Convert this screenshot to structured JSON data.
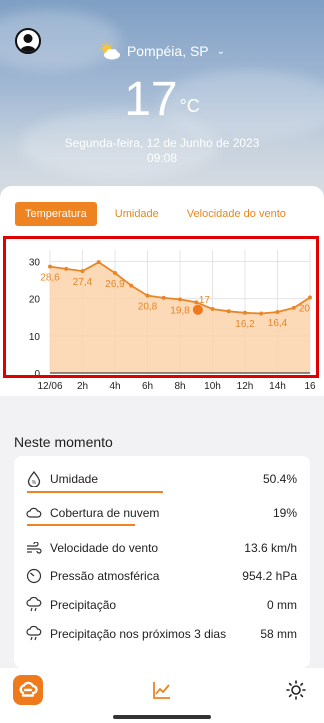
{
  "header": {
    "location": "Pompéia, SP",
    "temperature": "17",
    "temp_unit": "°C",
    "date": "Segunda-feira, 12 de Junho de 2023",
    "time": "09:08"
  },
  "tabs": [
    {
      "label": "Temperatura",
      "active": true
    },
    {
      "label": "Umidade",
      "active": false
    },
    {
      "label": "Velocidade do vento",
      "active": false
    }
  ],
  "chart_data": {
    "type": "area",
    "x_ticks": [
      "12/06",
      "2h",
      "4h",
      "6h",
      "8h",
      "10h",
      "12h",
      "14h",
      "16"
    ],
    "y_ticks": [
      "0",
      "10",
      "20",
      "30"
    ],
    "ylim": [
      0,
      32
    ],
    "xlim": [
      0,
      16
    ],
    "series": [
      {
        "x": [
          0,
          1,
          2,
          3,
          4,
          5,
          6,
          7,
          8,
          9,
          10,
          11,
          12,
          13,
          14,
          15,
          16
        ],
        "values": [
          28.6,
          28,
          27.4,
          29.8,
          26.9,
          23.5,
          20.8,
          20.2,
          19.8,
          19,
          17.2,
          16.6,
          16.2,
          16.0,
          16.4,
          17.5,
          20.3
        ]
      }
    ],
    "data_labels": [
      {
        "x": 0,
        "text": "28,6"
      },
      {
        "x": 2,
        "text": "27,4"
      },
      {
        "x": 4,
        "text": "26,9"
      },
      {
        "x": 6,
        "text": "20,8"
      },
      {
        "x": 8,
        "text": "19,8"
      },
      {
        "x": 9.5,
        "text": "17"
      },
      {
        "x": 12,
        "text": "16,2"
      },
      {
        "x": 14,
        "text": "16,4"
      },
      {
        "x": 16,
        "text": "20"
      }
    ],
    "current": {
      "x": 9.1,
      "y": 17
    },
    "colors": {
      "line": "#e8862a",
      "fill": "#fbd2aa",
      "grid": "#e4e4e4"
    },
    "grid": true
  },
  "now": {
    "title": "Neste momento",
    "items": [
      {
        "icon": "humidity-drop-icon",
        "label": "Umidade",
        "value": "50.4%"
      },
      {
        "icon": "cloud-icon",
        "label": "Cobertura de nuvem",
        "value": "19%"
      },
      {
        "icon": "wind-icon",
        "label": "Velocidade do vento",
        "value": "13.6 km/h"
      },
      {
        "icon": "gauge-icon",
        "label": "Pressão atmosférica",
        "value": "954.2 hPa"
      },
      {
        "icon": "rain-cloud-icon",
        "label": "Precipitação",
        "value": "0 mm"
      },
      {
        "icon": "rain-cloud-icon",
        "label": "Precipitação nos próximos 3 dias",
        "value": "58 mm"
      }
    ]
  },
  "nav": {
    "items": [
      {
        "icon": "app-logo-icon"
      },
      {
        "icon": "chart-icon"
      },
      {
        "icon": "sun-icon"
      }
    ]
  },
  "colors": {
    "accent": "#ee8322",
    "highlight": "#e00000"
  }
}
